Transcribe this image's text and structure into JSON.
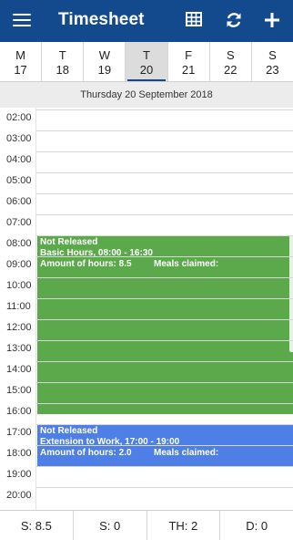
{
  "app": {
    "title": "Timesheet",
    "header_color": "#134a8e",
    "icons": [
      "menu-icon",
      "table-grid-icon",
      "refresh-icon",
      "add-icon"
    ]
  },
  "week": {
    "days": [
      {
        "weekday": "M",
        "date": "17",
        "selected": false
      },
      {
        "weekday": "T",
        "date": "18",
        "selected": false
      },
      {
        "weekday": "W",
        "date": "19",
        "selected": false
      },
      {
        "weekday": "T",
        "date": "20",
        "selected": true
      },
      {
        "weekday": "F",
        "date": "21",
        "selected": false
      },
      {
        "weekday": "S",
        "date": "22",
        "selected": false
      },
      {
        "weekday": "S",
        "date": "23",
        "selected": false
      }
    ]
  },
  "selected_date_label": "Thursday 20 September 2018",
  "timeline": {
    "hours": [
      "02:00",
      "03:00",
      "04:00",
      "05:00",
      "06:00",
      "07:00",
      "08:00",
      "09:00",
      "10:00",
      "11:00",
      "12:00",
      "13:00",
      "14:00",
      "15:00",
      "16:00",
      "17:00",
      "18:00",
      "19:00",
      "20:00"
    ]
  },
  "events": [
    {
      "status": "Not Released",
      "description": "Basic Hours, 08:00 - 16:30",
      "hours_label": "Amount of hours: 8.5",
      "meals_label": "Meals claimed:",
      "start": "08:00",
      "end": "16:30",
      "color": "#5ba94b"
    },
    {
      "status": "Not Released",
      "description": "Extension to Work, 17:00 - 19:00",
      "hours_label": "Amount of hours: 2.0",
      "meals_label": "Meals claimed:",
      "start": "17:00",
      "end": "19:00",
      "color": "#4d7fe6"
    }
  ],
  "totals": [
    {
      "label": "S: 8.5"
    },
    {
      "label": "S: 0"
    },
    {
      "label": "TH: 2"
    },
    {
      "label": "D: 0"
    }
  ]
}
